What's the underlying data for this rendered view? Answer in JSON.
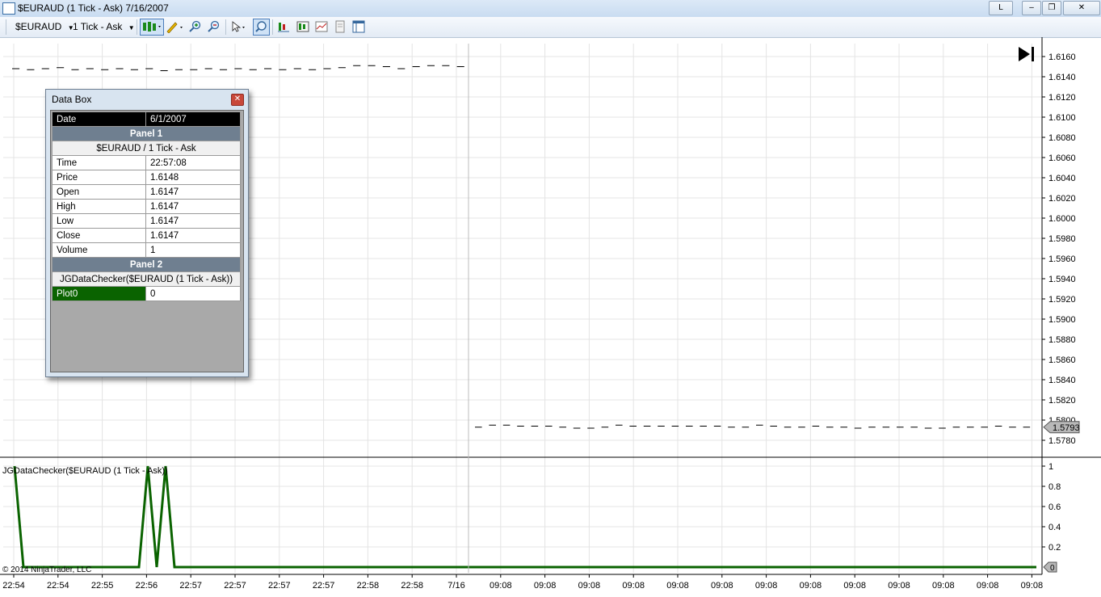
{
  "window": {
    "title": "$EURAUD (1 Tick - Ask)  7/16/2007",
    "btn_l": "L"
  },
  "toolbar": {
    "instrument": "$EURAUD",
    "interval": "1 Tick - Ask"
  },
  "colors": {
    "plot_green": "#0a6300",
    "price_dash": "#000000",
    "panel_header": "#6f7f90"
  },
  "databox": {
    "title": "Data Box",
    "date_label": "Date",
    "date_value": "6/1/2007",
    "panel1": "Panel 1",
    "panel1_series": "$EURAUD / 1 Tick - Ask",
    "rows": [
      {
        "k": "Time",
        "v": "22:57:08"
      },
      {
        "k": "Price",
        "v": "1.6148"
      },
      {
        "k": "Open",
        "v": "1.6147"
      },
      {
        "k": "High",
        "v": "1.6147"
      },
      {
        "k": "Low",
        "v": "1.6147"
      },
      {
        "k": "Close",
        "v": "1.6147"
      },
      {
        "k": "Volume",
        "v": "1"
      }
    ],
    "panel2": "Panel 2",
    "panel2_series": "JGDataChecker($EURAUD (1 Tick - Ask))",
    "plot_label": "Plot0",
    "plot_value": "0"
  },
  "chart_data": {
    "type": "line",
    "panels": [
      {
        "name": "price",
        "ylim": [
          1.577,
          1.617
        ],
        "y_ticks": [
          "1.6160",
          "1.6140",
          "1.6120",
          "1.6100",
          "1.6080",
          "1.6060",
          "1.6040",
          "1.6020",
          "1.6000",
          "1.5980",
          "1.5960",
          "1.5940",
          "1.5920",
          "1.5900",
          "1.5880",
          "1.5860",
          "1.5840",
          "1.5820",
          "1.5800",
          "1.5780"
        ],
        "last_value_label": "1.5793",
        "segments": [
          {
            "y": [
              1.6148,
              1.6147,
              1.6148,
              1.6149,
              1.6147,
              1.6148,
              1.6147,
              1.6148,
              1.6147,
              1.6148,
              1.6146,
              1.6147,
              1.6147,
              1.6148,
              1.6147,
              1.6148,
              1.6147,
              1.6148,
              1.6147,
              1.6148,
              1.6147,
              1.6148,
              1.6149,
              1.6151,
              1.6151,
              1.615,
              1.6148,
              1.615,
              1.6151,
              1.6151,
              1.615
            ]
          },
          {
            "y": [
              1.5793,
              1.5795,
              1.5795,
              1.5794,
              1.5794,
              1.5794,
              1.5793,
              1.5792,
              1.5792,
              1.5793,
              1.5795,
              1.5794,
              1.5794,
              1.5794,
              1.5794,
              1.5794,
              1.5794,
              1.5794,
              1.5793,
              1.5793,
              1.5795,
              1.5794,
              1.5793,
              1.5793,
              1.5794,
              1.5793,
              1.5793,
              1.5792,
              1.5793,
              1.5793,
              1.5793,
              1.5793,
              1.5792,
              1.5792,
              1.5793,
              1.5793,
              1.5793,
              1.5794,
              1.5793,
              1.5793
            ]
          }
        ]
      },
      {
        "name": "JGDataChecker($EURAUD (1 Tick - Ask))",
        "ylim": [
          0,
          1.05
        ],
        "y_ticks": [
          "1",
          "0.8",
          "0.6",
          "0.4",
          "0.2"
        ],
        "last_value_label": "0",
        "values": [
          1,
          0,
          0,
          0,
          0,
          0,
          0,
          0,
          0,
          0,
          0,
          0,
          0,
          0,
          1,
          0,
          1,
          0,
          0,
          0,
          0,
          0,
          0,
          0,
          0,
          0,
          0,
          0,
          0,
          0,
          0,
          0,
          0,
          0,
          0,
          0,
          0,
          0,
          0,
          0,
          0,
          0,
          0,
          0,
          0,
          0,
          0,
          0,
          0,
          0,
          0,
          0,
          0,
          0,
          0,
          0,
          0,
          0,
          0,
          0,
          0,
          0,
          0,
          0
        ]
      }
    ],
    "x_ticks": [
      "22:54",
      "22:54",
      "22:55",
      "22:56",
      "22:57",
      "22:57",
      "22:57",
      "22:57",
      "22:58",
      "22:58",
      "7/16",
      "09:08",
      "09:08",
      "09:08",
      "09:08",
      "09:08",
      "09:08",
      "09:08",
      "09:08",
      "09:08",
      "09:08",
      "09:08",
      "09:08",
      "09:08"
    ],
    "grid": true
  },
  "copyright": "© 2014 NinjaTrader, LLC"
}
